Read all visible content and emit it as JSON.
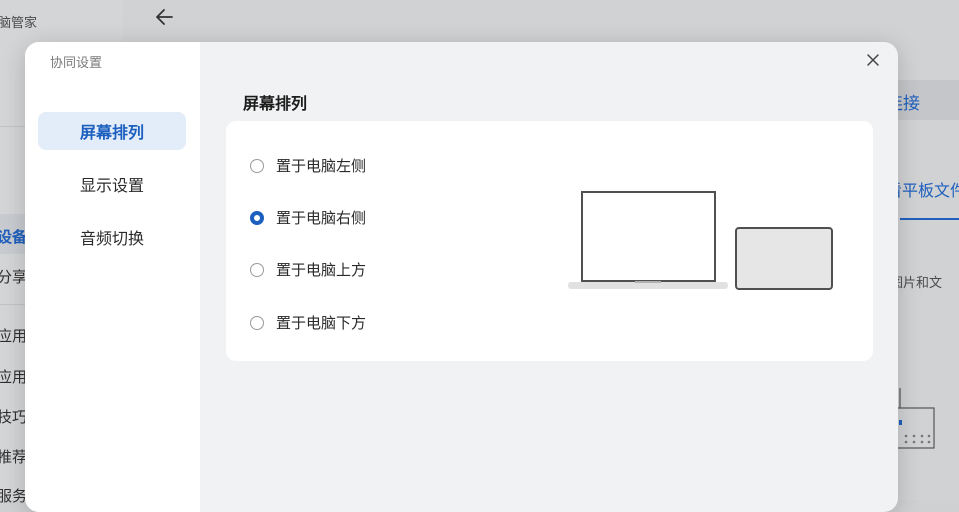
{
  "background": {
    "brand": "脑管家",
    "sidebar_items": [
      {
        "label": "设备",
        "active": true
      },
      {
        "label": "分享",
        "active": false
      },
      {
        "label": "应用",
        "active": false
      },
      {
        "label": "应用",
        "active": false
      },
      {
        "label": "技巧",
        "active": false
      },
      {
        "label": "推荐",
        "active": false
      },
      {
        "label": "服务",
        "active": false
      }
    ],
    "connect_label": "连接",
    "tab_label": "看平板文件",
    "desc": "图片和文"
  },
  "dialog": {
    "title": "协同设置",
    "nav": [
      {
        "label": "屏幕排列",
        "active": true
      },
      {
        "label": "显示设置",
        "active": false
      },
      {
        "label": "音频切换",
        "active": false
      }
    ],
    "section_title": "屏幕排列",
    "options": [
      {
        "label": "置于电脑左侧",
        "checked": false
      },
      {
        "label": "置于电脑右侧",
        "checked": true
      },
      {
        "label": "置于电脑上方",
        "checked": false
      },
      {
        "label": "置于电脑下方",
        "checked": false
      }
    ]
  },
  "colors": {
    "accent": "#1d5fbf",
    "nav_active_bg": "#e3edf9",
    "panel_bg": "#f0f2f3"
  },
  "icons": {
    "back": "arrow-left-icon",
    "close": "close-icon",
    "radio": "radio-icon"
  }
}
